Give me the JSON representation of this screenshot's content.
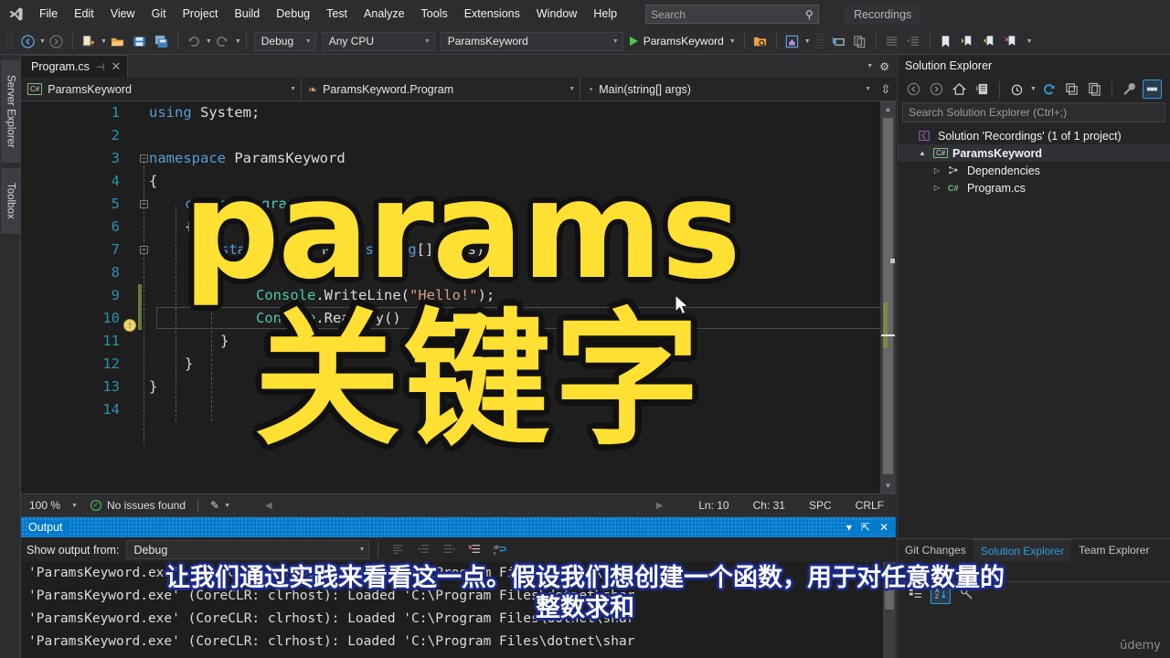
{
  "app": {
    "window_title": "Recordings",
    "logo_icon": "visual-studio-logo"
  },
  "menu": {
    "items": [
      {
        "label": "File"
      },
      {
        "label": "Edit"
      },
      {
        "label": "View"
      },
      {
        "label": "Git"
      },
      {
        "label": "Project"
      },
      {
        "label": "Build"
      },
      {
        "label": "Debug"
      },
      {
        "label": "Test"
      },
      {
        "label": "Analyze"
      },
      {
        "label": "Tools"
      },
      {
        "label": "Extensions"
      },
      {
        "label": "Window"
      },
      {
        "label": "Help"
      }
    ]
  },
  "search": {
    "placeholder": "Search",
    "icon": "search-icon"
  },
  "toolbar": {
    "back_icon": "navigate-back-icon",
    "forward_icon": "navigate-forward-icon",
    "new_item_icon": "new-item-icon",
    "open_icon": "open-file-icon",
    "save_icon": "save-icon",
    "save_all_icon": "save-all-icon",
    "undo_icon": "undo-icon",
    "redo_icon": "redo-icon",
    "configuration": "Debug",
    "platform": "Any CPU",
    "startup_project": "ParamsKeyword",
    "run_label": "ParamsKeyword",
    "run_icon": "play-icon",
    "find_in_files_icon": "find-in-files-icon",
    "live_share_icon": "home-icon",
    "select_icon": "pointer-icon",
    "copy_icon": "copy-icon",
    "indent_icon": "indent-icon",
    "outdent_icon": "outdent-icon",
    "bookmark_icon": "bookmark-icon",
    "next_bookmark_icon": "next-bookmark-icon",
    "prev_bookmark_icon": "previous-bookmark-icon",
    "clear_bookmark_icon": "clear-bookmark-icon",
    "overflow_icon": "toolbar-overflow-icon"
  },
  "left_dock": {
    "tabs": [
      {
        "label": "Server Explorer"
      },
      {
        "label": "Toolbox"
      }
    ]
  },
  "editor": {
    "tab": {
      "label": "Program.cs",
      "pin_icon": "pin-icon",
      "close_icon": "close-icon"
    },
    "navbar": {
      "project": "ParamsKeyword",
      "project_icon": "csharp-project-icon",
      "type": "ParamsKeyword.Program",
      "type_icon": "class-icon",
      "member": "Main(string[] args)",
      "member_icon": "method-icon",
      "split_icon": "split-window-icon"
    },
    "lines": [
      {
        "n": "1",
        "indent": 0,
        "tokens": [
          {
            "t": "using",
            "c": "kw"
          },
          {
            "t": " System;",
            "c": "pl"
          }
        ]
      },
      {
        "n": "2",
        "indent": 0,
        "tokens": []
      },
      {
        "n": "3",
        "indent": 0,
        "tokens": [
          {
            "t": "namespace",
            "c": "kw"
          },
          {
            "t": " ParamsKeyword",
            "c": "ns"
          }
        ]
      },
      {
        "n": "4",
        "indent": 0,
        "tokens": [
          {
            "t": "{",
            "c": "pl"
          }
        ]
      },
      {
        "n": "5",
        "indent": 1,
        "tokens": [
          {
            "t": "class",
            "c": "kw"
          },
          {
            "t": " ",
            "c": "pl"
          },
          {
            "t": "Program",
            "c": "ty"
          }
        ]
      },
      {
        "n": "6",
        "indent": 1,
        "tokens": [
          {
            "t": "{",
            "c": "pl"
          }
        ]
      },
      {
        "n": "7",
        "indent": 2,
        "tokens": [
          {
            "t": "static",
            "c": "kw"
          },
          {
            "t": " ",
            "c": "pl"
          },
          {
            "t": "void",
            "c": "kw"
          },
          {
            "t": " Main(",
            "c": "pl"
          },
          {
            "t": "string",
            "c": "kw"
          },
          {
            "t": "[] args)",
            "c": "pl"
          }
        ]
      },
      {
        "n": "8",
        "indent": 2,
        "tokens": [
          {
            "t": "{",
            "c": "pl"
          }
        ]
      },
      {
        "n": "9",
        "indent": 3,
        "tokens": [
          {
            "t": "Console",
            "c": "ty"
          },
          {
            "t": ".WriteLine(",
            "c": "pl"
          },
          {
            "t": "\"Hello!\"",
            "c": "st"
          },
          {
            "t": ");",
            "c": "pl"
          }
        ]
      },
      {
        "n": "10",
        "indent": 3,
        "tokens": [
          {
            "t": "Console",
            "c": "ty"
          },
          {
            "t": ".ReadKey()",
            "c": "pl"
          }
        ]
      },
      {
        "n": "11",
        "indent": 2,
        "tokens": [
          {
            "t": "}",
            "c": "pl"
          }
        ]
      },
      {
        "n": "12",
        "indent": 1,
        "tokens": [
          {
            "t": "}",
            "c": "pl"
          }
        ]
      },
      {
        "n": "13",
        "indent": 0,
        "tokens": [
          {
            "t": "}",
            "c": "pl"
          }
        ]
      },
      {
        "n": "14",
        "indent": 0,
        "tokens": []
      }
    ],
    "quick_action_icon": "lightbulb-icon",
    "status": {
      "zoom": "100 %",
      "issues": "No issues found",
      "issues_icon": "check-circle-icon",
      "pen_icon": "pen-icon",
      "line": "Ln: 10",
      "column": "Ch: 31",
      "spaces": "SPC",
      "eol": "CRLF"
    }
  },
  "solution_explorer": {
    "title": "Solution Explorer",
    "search_placeholder": "Search Solution Explorer (Ctrl+;)",
    "toolbar": {
      "back_icon": "back-icon",
      "forward_icon": "forward-icon",
      "home_icon": "home-icon",
      "pending_changes_icon": "pending-changes-filter-icon",
      "history_icon": "history-icon",
      "refresh_icon": "refresh-icon",
      "collapse_all_icon": "collapse-all-icon",
      "show_all_files_icon": "show-all-files-icon",
      "properties_icon": "properties-wrench-icon",
      "preview_icon": "preview-selected-items-icon"
    },
    "tree": [
      {
        "label": "Solution 'Recordings' (1 of 1 project)",
        "depth": 0,
        "twisty": "",
        "icon": "solution-icon",
        "bold": false
      },
      {
        "label": "ParamsKeyword",
        "depth": 1,
        "twisty": "▲",
        "icon": "csharp-project-icon",
        "bold": true
      },
      {
        "label": "Dependencies",
        "depth": 2,
        "twisty": "▷",
        "icon": "dependencies-icon",
        "bold": false
      },
      {
        "label": "Program.cs",
        "depth": 2,
        "twisty": "▷",
        "icon": "csharp-file-icon",
        "bold": false
      }
    ]
  },
  "bottom_right_dock": {
    "tabs": [
      {
        "label": "Git Changes",
        "active": false
      },
      {
        "label": "Solution Explorer",
        "active": true
      },
      {
        "label": "Team Explorer",
        "active": false
      }
    ],
    "properties_title": "Properties",
    "properties_toolbar": {
      "categorized_icon": "categorized-icon",
      "alphabetical_icon": "alphabetical-sort-icon",
      "property_pages_icon": "property-pages-icon"
    }
  },
  "output": {
    "title": "Output",
    "pin_icon": "pin-icon",
    "float_icon": "window-options-icon",
    "close_icon": "close-icon",
    "show_output_from_label": "Show output from:",
    "source": "Debug",
    "toolbar": {
      "find_message_icon": "find-message-icon",
      "go_to_previous_icon": "go-to-previous-message-icon",
      "go_to_next_icon": "go-to-next-message-icon",
      "clear_all_icon": "clear-all-icon",
      "toggle_wordwrap_icon": "toggle-word-wrap-icon"
    },
    "lines": [
      "'ParamsKeyword.exe' (CoreCLR: clrhost): Loaded 'C:\\Program Files\\dotnet\\shar",
      "'ParamsKeyword.exe' (CoreCLR: clrhost): Loaded 'C:\\Program Files\\dotnet\\shar",
      "'ParamsKeyword.exe' (CoreCLR: clrhost): Loaded 'C:\\Program Files\\dotnet\\shar",
      "'ParamsKeyword.exe' (CoreCLR: clrhost): Loaded 'C:\\Program Files\\dotnet\\shar"
    ]
  },
  "overlay": {
    "title_en": "params",
    "title_cjk": "关键字",
    "subtitle_line1": "让我们通过实践来看看这一点。假设我们想创建一个函数，用于对任意数量的",
    "subtitle_line2": "整数求和",
    "watermark": "ūdemy",
    "cursor_icon": "mouse-pointer-icon"
  },
  "colors": {
    "accent": "#007acc",
    "overlay_yellow": "#ffe033",
    "subtitle_outline": "#1a2a8a",
    "chrome": "#2d2d30",
    "editor_bg": "#1e1e1e"
  }
}
